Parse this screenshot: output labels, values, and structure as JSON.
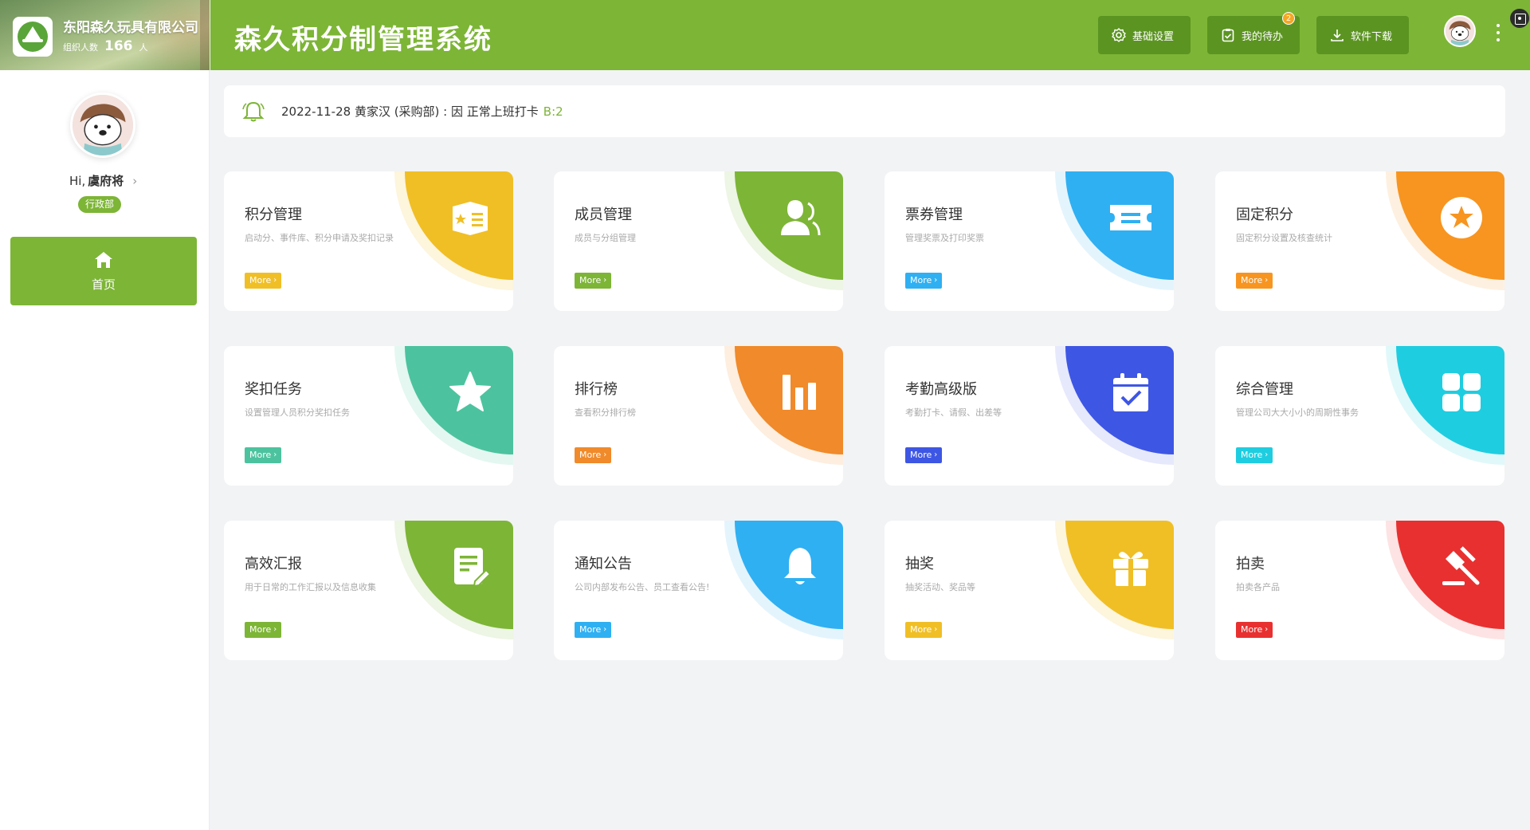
{
  "org": {
    "name": "东阳森久玩具有限公司",
    "count_label": "组织人数",
    "count": "166",
    "count_unit": "人"
  },
  "user": {
    "greeting": "Hi,",
    "name": "虞府将",
    "department": "行政部"
  },
  "nav": {
    "home_label": "首页"
  },
  "header": {
    "title": "森久积分制管理系统",
    "settings_label": "基础设置",
    "todo_label": "我的待办",
    "todo_badge": "2",
    "download_label": "软件下载"
  },
  "notice": {
    "text": "2022-11-28 黄家汉 (采购部) : 因 正常上班打卡",
    "tag": "B:2"
  },
  "more_label": "More",
  "colors": {
    "brand": "#7db536",
    "brand_dark": "#5c9422"
  },
  "cards": [
    {
      "title": "积分管理",
      "desc": "启动分、事件库、积分申请及奖扣记录",
      "color": "#f0bf25",
      "halo": "#fdf5dc",
      "icon": "card-list-icon"
    },
    {
      "title": "成员管理",
      "desc": "成员与分组管理",
      "color": "#7db536",
      "halo": "#edf5e4",
      "icon": "members-icon"
    },
    {
      "title": "票券管理",
      "desc": "管理奖票及打印奖票",
      "color": "#2fb0f2",
      "halo": "#e4f4fd",
      "icon": "ticket-icon"
    },
    {
      "title": "固定积分",
      "desc": "固定积分设置及核查统计",
      "color": "#f79520",
      "halo": "#fef0e0",
      "icon": "star-badge-icon"
    },
    {
      "title": "奖扣任务",
      "desc": "设置管理人员积分奖扣任务",
      "color": "#4cc39e",
      "halo": "#e4f7f1",
      "icon": "star-icon"
    },
    {
      "title": "排行榜",
      "desc": "查看积分排行榜",
      "color": "#f08a2a",
      "halo": "#fdeedf",
      "icon": "bar-chart-icon"
    },
    {
      "title": "考勤高级版",
      "desc": "考勤打卡、请假、出差等",
      "color": "#3e56e4",
      "halo": "#e6e9fc",
      "icon": "calendar-check-icon"
    },
    {
      "title": "综合管理",
      "desc": "管理公司大大小小的周期性事务",
      "color": "#1fcde0",
      "halo": "#e0f8fa",
      "icon": "grid-icon"
    },
    {
      "title": "高效汇报",
      "desc": "用于日常的工作汇报以及信息收集",
      "color": "#7db536",
      "halo": "#edf5e4",
      "icon": "report-icon"
    },
    {
      "title": "通知公告",
      "desc": "公司内部发布公告、员工查看公告!",
      "color": "#2fb0f2",
      "halo": "#e4f4fd",
      "icon": "bell-icon"
    },
    {
      "title": "抽奖",
      "desc": "抽奖活动、奖品等",
      "color": "#f0bf25",
      "halo": "#fdf5dc",
      "icon": "gift-icon"
    },
    {
      "title": "拍卖",
      "desc": "拍卖各产品",
      "color": "#e83030",
      "halo": "#fde3e3",
      "icon": "gavel-icon"
    }
  ]
}
